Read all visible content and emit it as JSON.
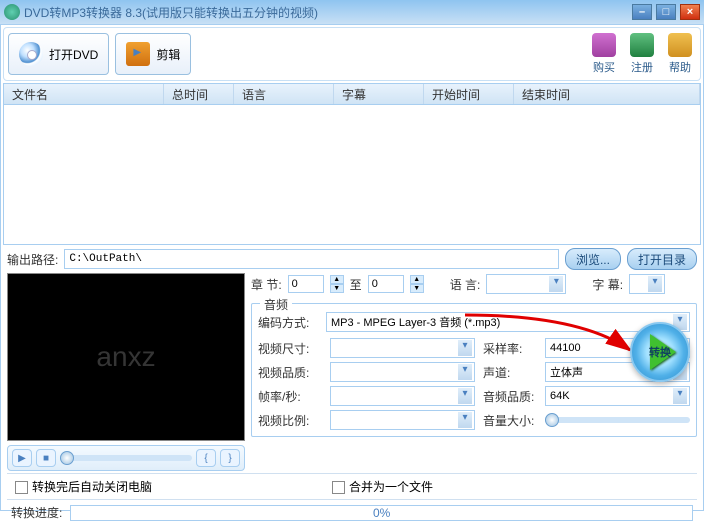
{
  "window": {
    "title": "DVD转MP3转换器 8.3(试用版只能转换出五分钟的视频)"
  },
  "toolbar": {
    "open_dvd": "打开DVD",
    "edit": "剪辑",
    "buy": "购买",
    "register": "注册",
    "help": "帮助"
  },
  "columns": {
    "filename": "文件名",
    "total_time": "总时间",
    "language": "语言",
    "subtitle": "字幕",
    "start_time": "开始时间",
    "end_time": "结束时间"
  },
  "output": {
    "label": "输出路径:",
    "path": "C:\\OutPath\\",
    "browse": "浏览...",
    "open_dir": "打开目录"
  },
  "chapter": {
    "label": "章 节:",
    "from": "0",
    "to_label": "至",
    "to": "0",
    "lang_label": "语 言:",
    "sub_label": "字 幕:"
  },
  "audio": {
    "group": "音频",
    "encode_label": "编码方式:",
    "encode_value": "MP3 - MPEG Layer-3 音频 (*.mp3)",
    "video_size_label": "视频尺寸:",
    "video_size_value": "",
    "sample_rate_label": "采样率:",
    "sample_rate_value": "44100",
    "video_quality_label": "视频品质:",
    "video_quality_value": "",
    "channel_label": "声道:",
    "channel_value": "立体声",
    "fps_label": "帧率/秒:",
    "fps_value": "",
    "audio_quality_label": "音频品质:",
    "audio_quality_value": "64K",
    "ratio_label": "视频比例:",
    "ratio_value": "",
    "volume_label": "音量大小:"
  },
  "convert_label": "转换",
  "checks": {
    "shutdown": "转换完后自动关闭电脑",
    "merge": "合并为一个文件"
  },
  "progress": {
    "label": "转换进度:",
    "percent": "0%"
  },
  "watermark": "anxz"
}
